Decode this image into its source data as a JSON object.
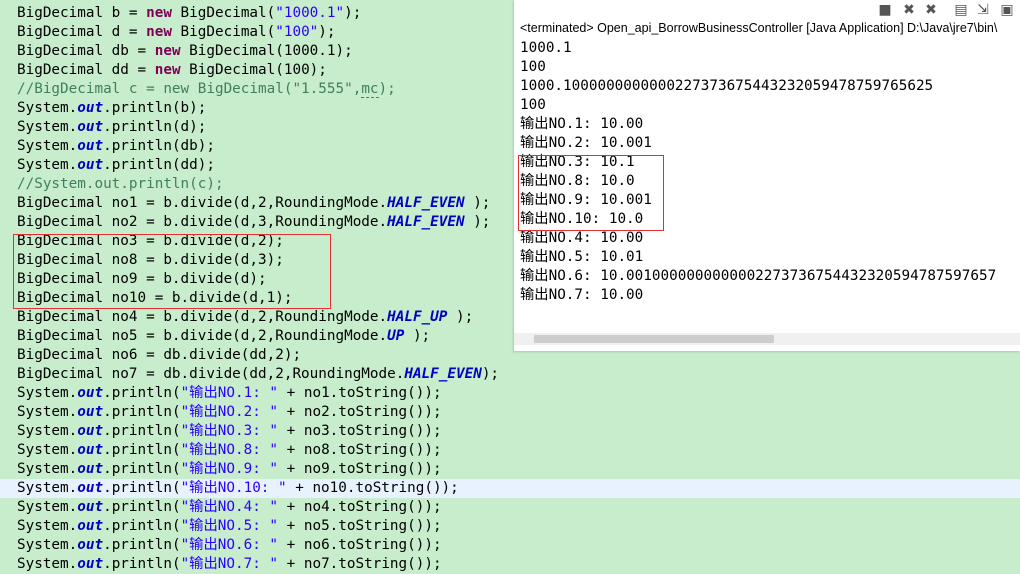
{
  "editor": {
    "lines": [
      [
        {
          "t": "BigDecimal b = "
        },
        {
          "t": "new",
          "c": "kw"
        },
        {
          "t": " BigDecimal("
        },
        {
          "t": "\"1000.1\"",
          "c": "str"
        },
        {
          "t": ");"
        }
      ],
      [
        {
          "t": "BigDecimal d = "
        },
        {
          "t": "new",
          "c": "kw"
        },
        {
          "t": " BigDecimal("
        },
        {
          "t": "\"100\"",
          "c": "str"
        },
        {
          "t": ");"
        }
      ],
      [
        {
          "t": "BigDecimal db = "
        },
        {
          "t": "new",
          "c": "kw"
        },
        {
          "t": " BigDecimal(1000.1);"
        }
      ],
      [
        {
          "t": "BigDecimal dd = "
        },
        {
          "t": "new",
          "c": "kw"
        },
        {
          "t": " BigDecimal(100);"
        }
      ],
      [
        {
          "t": "//BigDecimal c = new BigDecimal(\"1.555\",",
          "c": "cmt"
        },
        {
          "t": "mc",
          "c": "cmt warn"
        },
        {
          "t": ");",
          "c": "cmt"
        }
      ],
      [
        {
          "t": "System."
        },
        {
          "t": "out",
          "c": "fld"
        },
        {
          "t": ".println(b);"
        }
      ],
      [
        {
          "t": "System."
        },
        {
          "t": "out",
          "c": "fld"
        },
        {
          "t": ".println(d);"
        }
      ],
      [
        {
          "t": "System."
        },
        {
          "t": "out",
          "c": "fld"
        },
        {
          "t": ".println(db);"
        }
      ],
      [
        {
          "t": "System."
        },
        {
          "t": "out",
          "c": "fld"
        },
        {
          "t": ".println(dd);"
        }
      ],
      [
        {
          "t": "//System.out.println(c);",
          "c": "cmt"
        }
      ],
      [
        {
          "t": "BigDecimal no1 = b.divide(d,2,RoundingMode."
        },
        {
          "t": "HALF_EVEN",
          "c": "fld"
        },
        {
          "t": " );"
        }
      ],
      [
        {
          "t": "BigDecimal no2 = b.divide(d,3,RoundingMode."
        },
        {
          "t": "HALF_EVEN",
          "c": "fld"
        },
        {
          "t": " );"
        }
      ],
      [
        {
          "t": "BigDecimal no3 = b.divide(d,2);"
        }
      ],
      [
        {
          "t": "BigDecimal no8 = b.divide(d,3);"
        }
      ],
      [
        {
          "t": "BigDecimal no9 = b.divide(d);"
        }
      ],
      [
        {
          "t": "BigDecimal no10 = b.divide(d,1);"
        }
      ],
      [
        {
          "t": "BigDecimal no4 = b.divide(d,2,RoundingMode."
        },
        {
          "t": "HALF_UP",
          "c": "fld"
        },
        {
          "t": " );"
        }
      ],
      [
        {
          "t": "BigDecimal no5 = b.divide(d,2,RoundingMode."
        },
        {
          "t": "UP",
          "c": "fld"
        },
        {
          "t": " );"
        }
      ],
      [
        {
          "t": "BigDecimal no6 = db.divide(dd,2);"
        }
      ],
      [
        {
          "t": "BigDecimal no7 = db.divide(dd,2,RoundingMode."
        },
        {
          "t": "HALF_EVEN",
          "c": "fld"
        },
        {
          "t": ");"
        }
      ],
      [
        {
          "t": "System."
        },
        {
          "t": "out",
          "c": "fld"
        },
        {
          "t": ".println("
        },
        {
          "t": "\"输出NO.1: \"",
          "c": "str"
        },
        {
          "t": " + no1.toString());"
        }
      ],
      [
        {
          "t": "System."
        },
        {
          "t": "out",
          "c": "fld"
        },
        {
          "t": ".println("
        },
        {
          "t": "\"输出NO.2: \"",
          "c": "str"
        },
        {
          "t": " + no2.toString());"
        }
      ],
      [
        {
          "t": "System."
        },
        {
          "t": "out",
          "c": "fld"
        },
        {
          "t": ".println("
        },
        {
          "t": "\"输出NO.3: \"",
          "c": "str"
        },
        {
          "t": " + no3.toString());"
        }
      ],
      [
        {
          "t": "System."
        },
        {
          "t": "out",
          "c": "fld"
        },
        {
          "t": ".println("
        },
        {
          "t": "\"输出NO.8: \"",
          "c": "str"
        },
        {
          "t": " + no8.toString());"
        }
      ],
      [
        {
          "t": "System."
        },
        {
          "t": "out",
          "c": "fld"
        },
        {
          "t": ".println("
        },
        {
          "t": "\"输出NO.9: \"",
          "c": "str"
        },
        {
          "t": " + no9.toString());"
        }
      ],
      [
        {
          "t": "System."
        },
        {
          "t": "out",
          "c": "fld"
        },
        {
          "t": ".println("
        },
        {
          "t": "\"输出NO.10: \"",
          "c": "str"
        },
        {
          "t": " + no10.toString());"
        }
      ],
      [
        {
          "t": "System."
        },
        {
          "t": "out",
          "c": "fld"
        },
        {
          "t": ".println("
        },
        {
          "t": "\"输出NO.4: \"",
          "c": "str"
        },
        {
          "t": " + no4.toString());"
        }
      ],
      [
        {
          "t": "System."
        },
        {
          "t": "out",
          "c": "fld"
        },
        {
          "t": ".println("
        },
        {
          "t": "\"输出NO.5: \"",
          "c": "str"
        },
        {
          "t": " + no5.toString());"
        }
      ],
      [
        {
          "t": "System."
        },
        {
          "t": "out",
          "c": "fld"
        },
        {
          "t": ".println("
        },
        {
          "t": "\"输出NO.6: \"",
          "c": "str"
        },
        {
          "t": " + no6.toString());"
        }
      ],
      [
        {
          "t": "System."
        },
        {
          "t": "out",
          "c": "fld"
        },
        {
          "t": ".println("
        },
        {
          "t": "\"输出NO.7: \"",
          "c": "str"
        },
        {
          "t": " + no7.toString());"
        }
      ]
    ],
    "current_line": 25,
    "colors": {
      "background": "#c7edcc",
      "keyword": "#7f0055",
      "string": "#2a00ff",
      "field": "#0000c0",
      "comment": "#3f7f5f",
      "highlight_box": "#e03030"
    }
  },
  "console": {
    "toolbar_icons": [
      "terminate-icon",
      "remove-launch-icon",
      "remove-all-terminated-icon",
      "scroll-lock-icon",
      "word-wrap-icon",
      "pin-console-icon"
    ],
    "status": "<terminated> Open_api_BorrowBusinessController [Java Application] D:\\Java\\jre7\\bin\\",
    "lines": [
      "1000.1",
      "100",
      "1000.100000000000022737367544323205947875976562​5",
      "100",
      "输出NO.1: 10.00",
      "输出NO.2: 10.001",
      "输出NO.3: 10.1",
      "输出NO.8: 10.0",
      "输出NO.9: 10.001",
      "输出NO.10: 10.0",
      "输出NO.4: 10.00",
      "输出NO.5: 10.01",
      "输出NO.6: 10.001000000000000227373675443232059478759765​7",
      "输出NO.7: 10.00"
    ]
  }
}
